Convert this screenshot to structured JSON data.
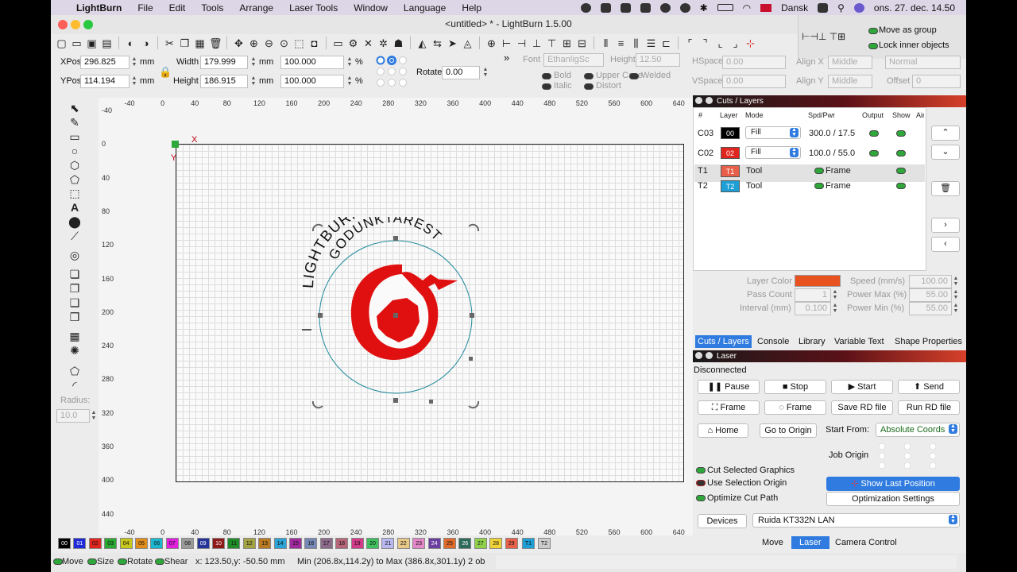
{
  "menubar": {
    "app": "LightBurn",
    "items": [
      "File",
      "Edit",
      "Tools",
      "Arrange",
      "Laser Tools",
      "Window",
      "Language",
      "Help"
    ],
    "language": "Dansk",
    "clock": "ons. 27. dec.  14.50"
  },
  "window": {
    "title": "<untitled> * - LightBurn 1.5.00"
  },
  "group_panel": {
    "move_as_group": "Move as group",
    "lock_inner": "Lock inner objects"
  },
  "numeric": {
    "xpos_label": "XPos",
    "xpos": "296.825",
    "ypos_label": "YPos",
    "ypos": "114.194",
    "unit": "mm",
    "width_label": "Width",
    "width": "179.999",
    "height_label": "Height",
    "height": "186.915",
    "scale_w": "100.000",
    "scale_h": "100.000",
    "pct": "%",
    "rotate_label": "Rotate",
    "rotate": "0.00"
  },
  "text_tools": {
    "font_label": "Font",
    "font": "EthanligSc",
    "height_label": "Height",
    "height": "12.50",
    "hspace_label": "HSpace",
    "hspace": "0.00",
    "vspace_label": "VSpace",
    "vspace": "0.00",
    "alignx_label": "Align X",
    "alignx": "Middle",
    "aligny_label": "Align Y",
    "aligny": "Middle",
    "normal": "Normal",
    "offset_label": "Offset",
    "offset": "0",
    "bold": "Bold",
    "italic": "Italic",
    "upper": "Upper Case",
    "distort": "Distort",
    "welded": "Welded"
  },
  "left_tools": {
    "radius_label": "Radius:",
    "radius": "10.0"
  },
  "ruler": {
    "top": [
      "-40",
      "0",
      "40",
      "80",
      "120",
      "160",
      "200",
      "240",
      "280",
      "320",
      "360",
      "400",
      "440",
      "480",
      "520",
      "560",
      "600",
      "640"
    ],
    "left": [
      "-40",
      "0",
      "40",
      "80",
      "120",
      "160",
      "200",
      "240",
      "280",
      "320",
      "360",
      "400",
      "440"
    ]
  },
  "canvas": {
    "origin_x": "X",
    "origin_y": "Y",
    "curved_text": "LIGHTBURN TEST",
    "curved_text2": "GODUNKTAREST"
  },
  "cuts": {
    "header": "Cuts / Layers",
    "cols": [
      "#",
      "Layer",
      "Mode",
      "Spd/Pwr",
      "Output",
      "Show",
      "Air"
    ],
    "rows": [
      {
        "id": "C03",
        "layer": "00",
        "mode": "Fill",
        "spdpwr": "300.0 / 17.5",
        "color": "#000000",
        "fg": "#ffffff"
      },
      {
        "id": "C02",
        "layer": "02",
        "mode": "Fill",
        "spdpwr": "100.0 / 55.0",
        "color": "#e0261f",
        "fg": "#ffffff"
      },
      {
        "id": "T1",
        "layer": "T1",
        "mode": "Tool",
        "spdpwr": "Frame",
        "color": "#e8604a",
        "fg": "#ffffff"
      },
      {
        "id": "T2",
        "layer": "T2",
        "mode": "Tool",
        "spdpwr": "Frame",
        "color": "#1e9fd6",
        "fg": "#ffffff"
      }
    ],
    "layer_color_label": "Layer Color",
    "pass_label": "Pass Count",
    "pass": "1",
    "interval_label": "Interval (mm)",
    "interval": "0.100",
    "speed_label": "Speed (mm/s)",
    "speed": "100.00",
    "pmax_label": "Power Max (%)",
    "pmax": "55.00",
    "pmin_label": "Power Min (%)",
    "pmin": "55.00"
  },
  "tabs": [
    "Cuts / Layers",
    "Console",
    "Library",
    "Variable Text",
    "Shape Properties"
  ],
  "laser": {
    "header": "Laser",
    "status": "Disconnected",
    "pause": "Pause",
    "stop": "Stop",
    "start": "Start",
    "send": "Send",
    "frame1": "Frame",
    "frame2": "Frame",
    "save_rd": "Save RD file",
    "run_rd": "Run RD file",
    "home": "Home",
    "goto_origin": "Go to Origin",
    "start_from_label": "Start From:",
    "start_from": "Absolute Coords",
    "job_origin": "Job Origin",
    "cut_selected": "Cut Selected Graphics",
    "use_sel_origin": "Use Selection Origin",
    "optimize": "Optimize Cut Path",
    "show_last": "Show Last Position",
    "opt_settings": "Optimization Settings",
    "devices": "Devices",
    "device": "Ruida KT332N LAN",
    "bottom_tabs": [
      "Move",
      "Laser",
      "Camera Control"
    ]
  },
  "palette": [
    "00",
    "01",
    "02",
    "03",
    "04",
    "05",
    "06",
    "07",
    "08",
    "09",
    "10",
    "11",
    "12",
    "13",
    "14",
    "15",
    "16",
    "17",
    "18",
    "19",
    "20",
    "21",
    "22",
    "23",
    "24",
    "25",
    "26",
    "27",
    "28",
    "29",
    "T1",
    "T2"
  ],
  "palette_colors": [
    "#000000",
    "#1f2bd8",
    "#e0261f",
    "#29a832",
    "#c6c61c",
    "#e28d1a",
    "#1bb7cf",
    "#e21fe0",
    "#9a9a9a",
    "#26349a",
    "#8f1a1a",
    "#1f8c2a",
    "#a3a341",
    "#b97a22",
    "#2aa4d6",
    "#a22a9f",
    "#7588b6",
    "#8b6a8a",
    "#b7667a",
    "#d43a8a",
    "#3fbf5e",
    "#b9b7f0",
    "#e6c887",
    "#e487c9",
    "#6a3fa0",
    "#e06a2a",
    "#2d6a5a",
    "#8fd24a",
    "#f0d236",
    "#e8604a",
    "#1e9fd6"
  ],
  "status": {
    "move": "Move",
    "size": "Size",
    "rotate": "Rotate",
    "shear": "Shear",
    "coords": "x: 123.50,y: -50.50 mm",
    "minmax": "Min (206.8x,114.2y) to Max (386.8x,301.1y)  2 ob"
  }
}
